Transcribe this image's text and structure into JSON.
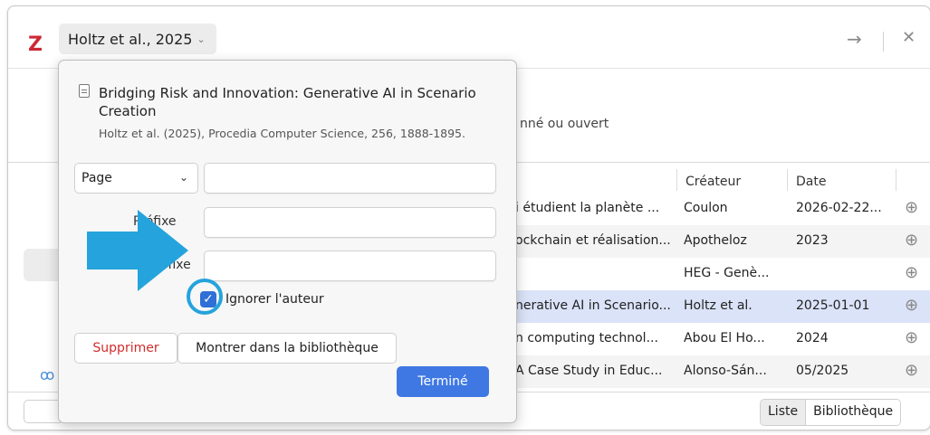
{
  "header": {
    "logo": "Z",
    "citation_label": "Holtz et al., 2025",
    "empty_message": "nné ou ouvert"
  },
  "table": {
    "headers": [
      "Créateur",
      "Date"
    ],
    "rows": [
      {
        "title": "i étudient la planète ...",
        "creator": "Coulon",
        "date": "2026-02-22..."
      },
      {
        "title": "ockchain et réalisation...",
        "creator": "Apotheloz",
        "date": "2023"
      },
      {
        "title": "",
        "creator": "HEG - Genè...",
        "date": ""
      },
      {
        "title": "nerative AI in Scenario...",
        "creator": "Holtz et al.",
        "date": "2025-01-01"
      },
      {
        "title": "n computing technol...",
        "creator": "Abou El Ho...",
        "date": "2024"
      },
      {
        "title": "A Case Study in Educ...",
        "creator": "Alonso-Sán...",
        "date": "05/2025"
      }
    ],
    "selected_row": 3
  },
  "popup": {
    "item_title": "Bridging Risk and Innovation: Generative AI in Scenario Creation",
    "item_subtitle": "Holtz et al. (2025), Procedia Computer Science, 256, 1888-1895.",
    "locator_type": "Page",
    "locator_value": "",
    "prefix_label": "Préfixe",
    "prefix_value": "",
    "suffix_label": "Suffixe",
    "suffix_value": "",
    "suppress_author_label": "Ignorer l'auteur",
    "suppress_author_checked": true,
    "delete_label": "Supprimer",
    "show_in_library_label": "Montrer dans la bibliothèque",
    "done_label": "Terminé"
  },
  "footer": {
    "view_list": "Liste",
    "view_library": "Bibliothèque"
  },
  "colors": {
    "accent": "#3f78e3",
    "delete": "#d12c2c",
    "annotation": "#25a3dc"
  }
}
